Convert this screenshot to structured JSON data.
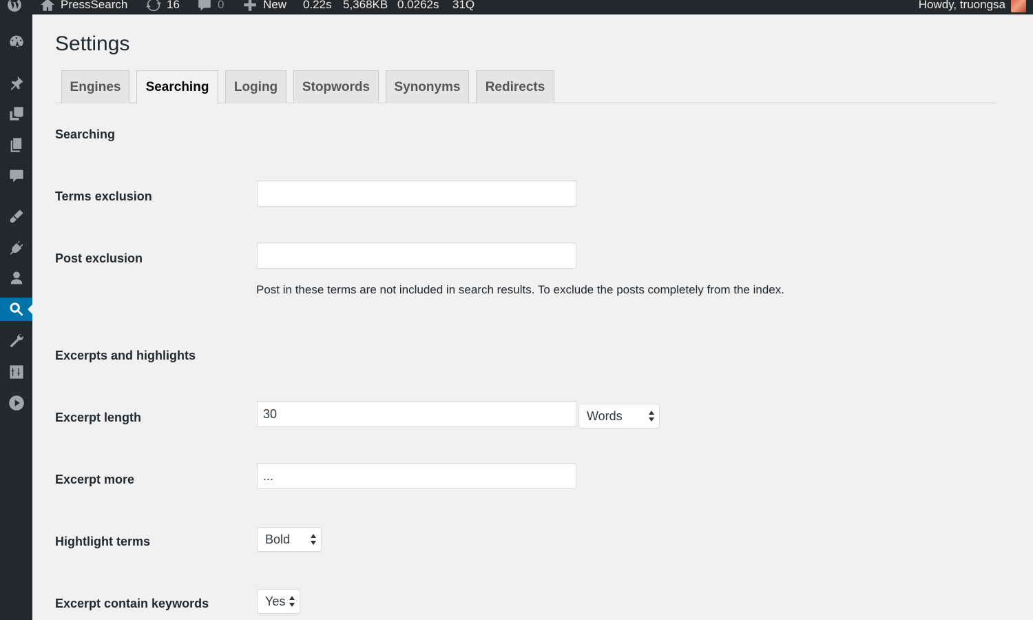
{
  "adminbar": {
    "site_name": "PressSearch",
    "updates_count": "16",
    "comments_count": "0",
    "new_label": "New",
    "stats": [
      "0.22s",
      "5,368KB",
      "0.0262s",
      "31Q"
    ],
    "howdy": "Howdy, truongsa"
  },
  "sidebar": {
    "items": [
      {
        "icon": "dashboard-icon"
      },
      {
        "icon": "pin-icon"
      },
      {
        "icon": "media-icon"
      },
      {
        "icon": "pages-icon"
      },
      {
        "icon": "comments-icon"
      },
      {
        "icon": "appearance-icon"
      },
      {
        "icon": "plugins-icon"
      },
      {
        "icon": "users-icon"
      },
      {
        "icon": "search-icon",
        "current": true
      },
      {
        "icon": "tools-icon"
      },
      {
        "icon": "settings-icon"
      },
      {
        "icon": "play-icon"
      }
    ]
  },
  "page": {
    "title": "Settings",
    "tabs": [
      {
        "label": "Engines"
      },
      {
        "label": "Searching",
        "active": true
      },
      {
        "label": "Loging"
      },
      {
        "label": "Stopwords"
      },
      {
        "label": "Synonyms"
      },
      {
        "label": "Redirects"
      }
    ]
  },
  "searching": {
    "section_title": "Searching",
    "terms_exclusion_label": "Terms exclusion",
    "terms_exclusion_value": "",
    "post_exclusion_label": "Post exclusion",
    "post_exclusion_value": "",
    "post_exclusion_desc": "Post in these terms are not included in search results. To exclude the posts completely from the index."
  },
  "excerpts": {
    "section_title": "Excerpts and highlights",
    "excerpt_length_label": "Excerpt length",
    "excerpt_length_value": "30",
    "excerpt_length_unit": "Words",
    "excerpt_more_label": "Excerpt more",
    "excerpt_more_value": "...",
    "highlight_terms_label": "Hightlight terms",
    "highlight_terms_value": "Bold",
    "contain_keywords_label": "Excerpt contain keywords",
    "contain_keywords_value": "Yes"
  }
}
